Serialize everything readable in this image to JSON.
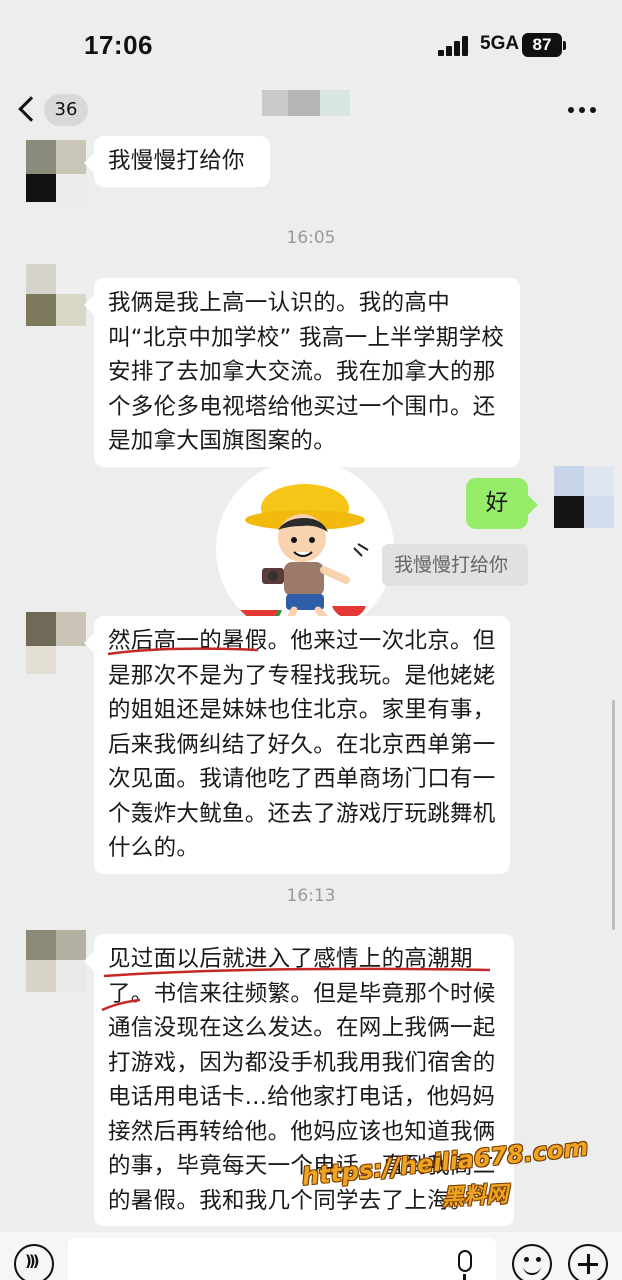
{
  "status": {
    "time": "17:06",
    "network": "5GA",
    "battery": "87"
  },
  "nav": {
    "unread_count": "36"
  },
  "messages": [
    {
      "type": "text",
      "side": "left",
      "text": "我慢慢打给你"
    },
    {
      "type": "time",
      "text": "16:05"
    },
    {
      "type": "text",
      "side": "left",
      "text": "我俩是我上高一认识的。我的高中叫“北京中加学校” 我高一上半学期学校安排了去加拿大交流。我在加拿大的那个多伦多电视塔给他买过一个围巾。还是加拿大国旗图案的。"
    },
    {
      "type": "sticker",
      "side": "left",
      "icon": "cartoon-boy-sticker"
    },
    {
      "type": "text",
      "side": "right",
      "text": "好",
      "quote": "我慢慢打给你"
    },
    {
      "type": "text",
      "side": "left",
      "text": "然后高一的暑假。他来过一次北京。但是那次不是为了专程找我玩。是他姥姥的姐姐还是妹妹也住北京。家里有事，后来我俩纠结了好久。在北京西单第一次见面。我请他吃了西单商场门口有一个轰炸大鱿鱼。还去了游戏厅玩跳舞机什么的。"
    },
    {
      "type": "time",
      "text": "16:13"
    },
    {
      "type": "text",
      "side": "left",
      "text": "见过面以后就进入了感情上的高潮期了。书信来往频繁。但是毕竟那个时候通信没现在这么发达。在网上我俩一起打游戏，因为都没手机我用我们宿舍的电话用电话卡...给他家打电话，他妈妈接然后再转给他。他妈应该也知道我俩的事，毕竟每天一个电话。直到我高二的暑假。我和我几个同学去了上海。"
    }
  ],
  "watermark": {
    "url": "https://heilia678.com",
    "name": "黑料网"
  },
  "input": {
    "placeholder": ""
  },
  "colors": {
    "background": "#ededed",
    "bubble_left": "#ffffff",
    "bubble_right": "#95ec69",
    "underline": "#c62828",
    "watermark": "#f0a522"
  }
}
